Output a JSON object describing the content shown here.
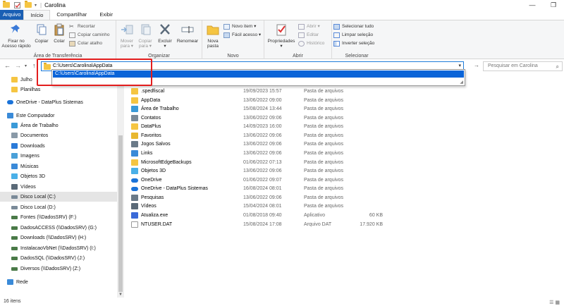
{
  "window": {
    "title": "Carolina",
    "minimize": "—",
    "restore": "❐"
  },
  "tabs": [
    {
      "label": "Arquivo"
    },
    {
      "label": "Início"
    },
    {
      "label": "Compartilhar"
    },
    {
      "label": "Exibir"
    }
  ],
  "ribbon": {
    "clipboard": {
      "group_label": "Área de Transferência",
      "pin_label": "Fixar no\nAcesso rápido",
      "copy_label": "Copiar",
      "paste_label": "Colar",
      "cut_label": "Recortar",
      "copy_path_label": "Copiar caminho",
      "paste_shortcut_label": "Colar atalho"
    },
    "organize": {
      "group_label": "Organizar",
      "move_label": "Mover\npara ▾",
      "copyto_label": "Copiar\npara ▾",
      "delete_label": "Excluir\n▾",
      "rename_label": "Renomear"
    },
    "new": {
      "group_label": "Novo",
      "new_folder_label": "Nova\npasta",
      "new_item_label": "Novo item ▾",
      "easy_access_label": "Fácil acesso ▾"
    },
    "open": {
      "group_label": "Abrir",
      "properties_label": "Propriedades\n▾",
      "open_label": "Abrir ▾",
      "edit_label": "Editar",
      "history_label": "Histórico"
    },
    "select": {
      "group_label": "Selecionar",
      "select_all_label": "Selecionar tudo",
      "clear_label": "Limpar seleção",
      "invert_label": "Inverter seleção"
    }
  },
  "address": {
    "value": "C:\\Users\\Carolina\\AppData",
    "suggestion": "C:\\Users\\Carolina\\AppData",
    "search_placeholder": "Pesquisar em Carolina"
  },
  "sidebar": {
    "items": [
      {
        "label": "Julho",
        "icon": "folder-icon",
        "color": "#f5c542"
      },
      {
        "label": "Planilhas",
        "icon": "folder-icon",
        "color": "#f5c542"
      },
      {
        "label": "OneDrive - DataPlus Sistemas",
        "icon": "cloud-icon",
        "color": "#1a73d9"
      },
      {
        "label": "Este Computador",
        "icon": "computer-icon",
        "color": "#3a8ad8"
      },
      {
        "label": "Área de Trabalho",
        "icon": "desktop-icon",
        "color": "#3a9ad8"
      },
      {
        "label": "Documentos",
        "icon": "documents-icon",
        "color": "#8a9aa8"
      },
      {
        "label": "Downloads",
        "icon": "download-icon",
        "color": "#2a7ad8"
      },
      {
        "label": "Imagens",
        "icon": "images-icon",
        "color": "#4aa0d8"
      },
      {
        "label": "Músicas",
        "icon": "music-icon",
        "color": "#3a8ad8"
      },
      {
        "label": "Objetos 3D",
        "icon": "cube-icon",
        "color": "#4ab0e8"
      },
      {
        "label": "Vídeos",
        "icon": "video-icon",
        "color": "#5a6a78"
      },
      {
        "label": "Disco Local (C:)",
        "icon": "drive-icon",
        "color": "#7a8a98"
      },
      {
        "label": "Disco Local (D:)",
        "icon": "drive-icon",
        "color": "#7a8a98"
      },
      {
        "label": "Fontes (\\\\DadosSRV) (F:)",
        "icon": "network-drive-icon",
        "color": "#4a7a48"
      },
      {
        "label": "DadosACCESS (\\\\DadosSRV) (G:)",
        "icon": "network-drive-icon",
        "color": "#4a7a48"
      },
      {
        "label": "Downloads (\\\\DadosSRV) (H:)",
        "icon": "network-drive-icon",
        "color": "#4a7a48"
      },
      {
        "label": "InstalacaoVbNet (\\\\DadosSRV) (I:)",
        "icon": "network-drive-icon",
        "color": "#4a7a48"
      },
      {
        "label": "DadosSQL (\\\\DadosSRV) (J:)",
        "icon": "network-drive-icon",
        "color": "#4a7a48"
      },
      {
        "label": "Diversos (\\\\DadosSRV) (Z:)",
        "icon": "network-drive-icon",
        "color": "#4a7a48"
      },
      {
        "label": "Rede",
        "icon": "network-icon",
        "color": "#3a8ad8"
      }
    ]
  },
  "files": [
    {
      "name": ".spedfiscal",
      "date": "19/09/2023 15:57",
      "type": "Pasta de arquivos",
      "size": "",
      "icon": "folder-icon",
      "color": "#f5c542"
    },
    {
      "name": "AppData",
      "date": "13/06/2022 09:00",
      "type": "Pasta de arquivos",
      "size": "",
      "icon": "folder-icon",
      "color": "#f5c542"
    },
    {
      "name": "Área de Trabalho",
      "date": "15/08/2024 13:44",
      "type": "Pasta de arquivos",
      "size": "",
      "icon": "desktop-icon",
      "color": "#3a9ad8"
    },
    {
      "name": "Contatos",
      "date": "13/06/2022 09:06",
      "type": "Pasta de arquivos",
      "size": "",
      "icon": "contacts-icon",
      "color": "#7a8a98"
    },
    {
      "name": "DataPlus",
      "date": "14/09/2023 16:00",
      "type": "Pasta de arquivos",
      "size": "",
      "icon": "folder-icon",
      "color": "#f5c542"
    },
    {
      "name": "Favoritos",
      "date": "13/06/2022 09:06",
      "type": "Pasta de arquivos",
      "size": "",
      "icon": "star-icon",
      "color": "#e8b830"
    },
    {
      "name": "Jogos Salvos",
      "date": "13/06/2022 09:06",
      "type": "Pasta de arquivos",
      "size": "",
      "icon": "games-icon",
      "color": "#6a7a88"
    },
    {
      "name": "Links",
      "date": "13/06/2022 09:06",
      "type": "Pasta de arquivos",
      "size": "",
      "icon": "links-icon",
      "color": "#3a8ad8"
    },
    {
      "name": "MicrosoftEdgeBackups",
      "date": "01/06/2022 07:13",
      "type": "Pasta de arquivos",
      "size": "",
      "icon": "folder-icon",
      "color": "#f5c542"
    },
    {
      "name": "Objetos 3D",
      "date": "13/06/2022 09:06",
      "type": "Pasta de arquivos",
      "size": "",
      "icon": "cube-icon",
      "color": "#4ab0e8"
    },
    {
      "name": "OneDrive",
      "date": "01/06/2022 09:07",
      "type": "Pasta de arquivos",
      "size": "",
      "icon": "cloud-icon",
      "color": "#1a73d9"
    },
    {
      "name": "OneDrive - DataPlus Sistemas",
      "date": "16/08/2024 08:01",
      "type": "Pasta de arquivos",
      "size": "",
      "icon": "cloud-icon",
      "color": "#1a73d9"
    },
    {
      "name": "Pesquisas",
      "date": "13/06/2022 09:06",
      "type": "Pasta de arquivos",
      "size": "",
      "icon": "search-icon",
      "color": "#6a7a88"
    },
    {
      "name": "Vídeos",
      "date": "15/04/2024 08:01",
      "type": "Pasta de arquivos",
      "size": "",
      "icon": "video-icon",
      "color": "#5a6a78"
    },
    {
      "name": "Atualiza.exe",
      "date": "01/08/2018 09:40",
      "type": "Aplicativo",
      "size": "60 KB",
      "icon": "exe-icon",
      "color": "#3a6ad8"
    },
    {
      "name": "NTUSER.DAT",
      "date": "15/08/2024 17:08",
      "type": "Arquivo DAT",
      "size": "17.920 KB",
      "icon": "file-icon",
      "color": "#ffffff"
    }
  ],
  "status": {
    "count": "16 itens"
  },
  "colors": {
    "accent": "#1e7bd8",
    "highlight": "#0a64d8",
    "annotation": "#e31d1d"
  }
}
